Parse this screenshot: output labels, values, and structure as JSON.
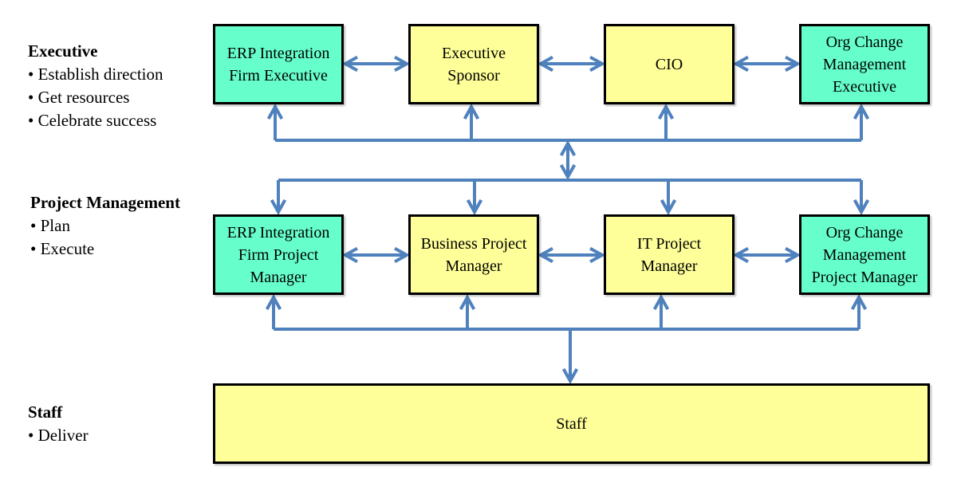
{
  "colors": {
    "partner": "#66FFCC",
    "internal": "#FFFF99",
    "connector": "#4F81BD"
  },
  "levels": [
    {
      "title": "Executive",
      "bullets": [
        "Establish direction",
        "Get resources",
        "Celebrate success"
      ]
    },
    {
      "title": "Project Management",
      "bullets": [
        "Plan",
        "Execute"
      ]
    },
    {
      "title": "Staff",
      "bullets": [
        "Deliver"
      ]
    }
  ],
  "executive_row": [
    {
      "label": "ERP Integration Firm Executive",
      "kind": "partner"
    },
    {
      "label": "Executive Sponsor",
      "kind": "internal"
    },
    {
      "label": "CIO",
      "kind": "internal"
    },
    {
      "label": "Org Change Management Executive",
      "kind": "partner"
    }
  ],
  "pm_row": [
    {
      "label": "ERP Integration Firm Project Manager",
      "kind": "partner"
    },
    {
      "label": "Business Project Manager",
      "kind": "internal"
    },
    {
      "label": "IT Project Manager",
      "kind": "internal"
    },
    {
      "label": "Org Change Management Project Manager",
      "kind": "partner"
    }
  ],
  "staff_box": {
    "label": "Staff",
    "kind": "internal"
  }
}
